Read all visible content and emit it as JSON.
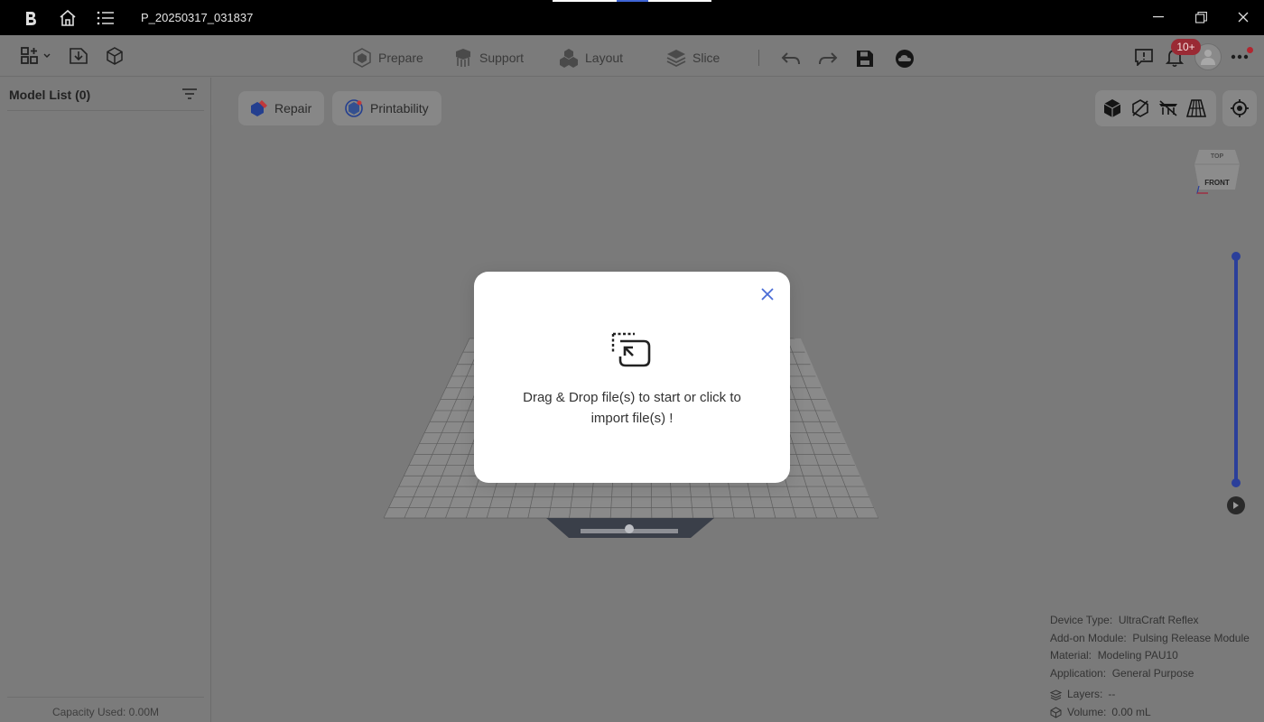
{
  "titlebar": {
    "project_name": "P_20250317_031837",
    "progress_fraction": 0.2
  },
  "toolbar": {
    "modes": [
      {
        "label": "Prepare",
        "icon": "prepare-icon"
      },
      {
        "label": "Support",
        "icon": "support-icon"
      },
      {
        "label": "Layout",
        "icon": "layout-icon"
      },
      {
        "label": "Slice",
        "icon": "slice-icon"
      }
    ],
    "notification_count": "10+"
  },
  "sidebar": {
    "title": "Model List (0)",
    "capacity": "Capacity Used: 0.00M"
  },
  "viewport": {
    "repair_label": "Repair",
    "printability_label": "Printability",
    "view_cube": {
      "top": "TOP",
      "front": "FRONT"
    }
  },
  "info": {
    "device_type_label": "Device Type:",
    "device_type_value": "UltraCraft Reflex",
    "addon_label": "Add-on Module:",
    "addon_value": "Pulsing Release Module",
    "material_label": "Material:",
    "material_value": "Modeling PAU10",
    "application_label": "Application:",
    "application_value": "General Purpose",
    "layers_label": "Layers:",
    "layers_value": "--",
    "volume_label": "Volume:",
    "volume_value": "0.00 mL"
  },
  "dialog": {
    "message": "Drag & Drop file(s) to start or click to import file(s) !"
  },
  "colors": {
    "accent": "#2b3f9a",
    "badge": "#9a2a34",
    "close": "#4a6cd6"
  }
}
